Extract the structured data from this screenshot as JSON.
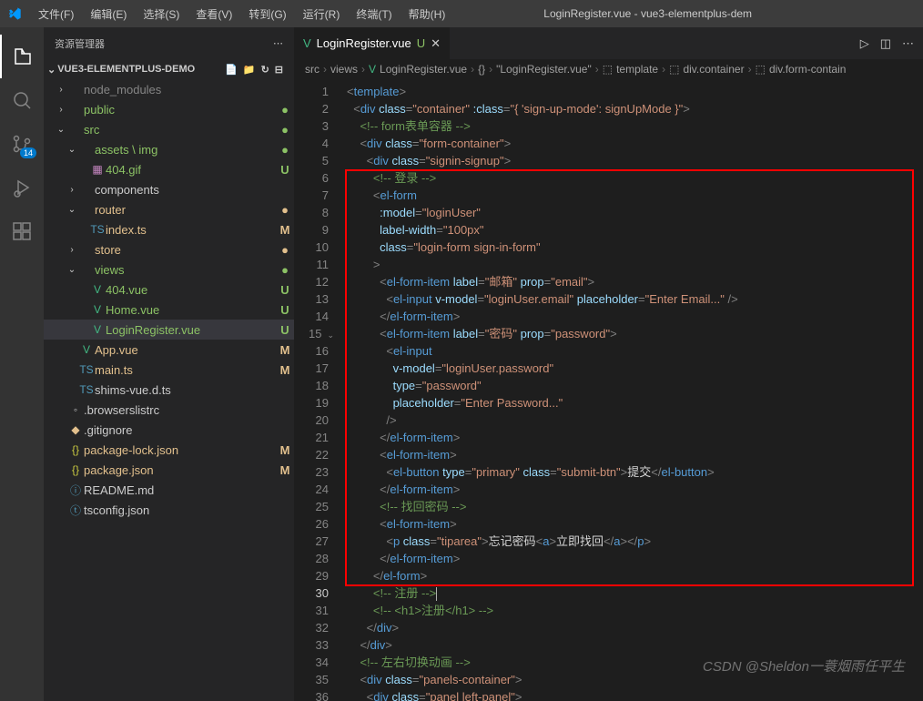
{
  "titlebar": {
    "menus": [
      "文件(F)",
      "编辑(E)",
      "选择(S)",
      "查看(V)",
      "转到(G)",
      "运行(R)",
      "终端(T)",
      "帮助(H)"
    ],
    "title": "LoginRegister.vue - vue3-elementplus-dem"
  },
  "activitybar": {
    "scm_badge": "14"
  },
  "sidebar": {
    "header": "资源管理器",
    "project": "VUE3-ELEMENTPLUS-DEMO",
    "tree": [
      {
        "indent": 1,
        "chev": "›",
        "icon": "",
        "iconClass": "gray",
        "label": "node_modules",
        "labelClass": "gray",
        "status": "",
        "statusClass": ""
      },
      {
        "indent": 1,
        "chev": "›",
        "icon": "",
        "iconClass": "",
        "label": "public",
        "labelClass": "green",
        "status": "●",
        "statusClass": "green"
      },
      {
        "indent": 1,
        "chev": "⌄",
        "icon": "",
        "iconClass": "",
        "label": "src",
        "labelClass": "green",
        "status": "●",
        "statusClass": "green"
      },
      {
        "indent": 2,
        "chev": "⌄",
        "icon": "",
        "iconClass": "",
        "label": "assets \\ img",
        "labelClass": "green",
        "status": "●",
        "statusClass": "green"
      },
      {
        "indent": 3,
        "chev": "",
        "icon": "▦",
        "iconClass": "purple",
        "label": "404.gif",
        "labelClass": "green",
        "status": "U",
        "statusClass": "green"
      },
      {
        "indent": 2,
        "chev": "›",
        "icon": "",
        "iconClass": "",
        "label": "components",
        "labelClass": "",
        "status": "",
        "statusClass": ""
      },
      {
        "indent": 2,
        "chev": "⌄",
        "icon": "",
        "iconClass": "",
        "label": "router",
        "labelClass": "orange",
        "status": "●",
        "statusClass": "orange"
      },
      {
        "indent": 3,
        "chev": "",
        "icon": "TS",
        "iconClass": "blue-ts",
        "label": "index.ts",
        "labelClass": "orange",
        "status": "M",
        "statusClass": "orange"
      },
      {
        "indent": 2,
        "chev": "›",
        "icon": "",
        "iconClass": "",
        "label": "store",
        "labelClass": "orange",
        "status": "●",
        "statusClass": "orange"
      },
      {
        "indent": 2,
        "chev": "⌄",
        "icon": "",
        "iconClass": "",
        "label": "views",
        "labelClass": "green",
        "status": "●",
        "statusClass": "green"
      },
      {
        "indent": 3,
        "chev": "",
        "icon": "V",
        "iconClass": "yellowv",
        "label": "404.vue",
        "labelClass": "green",
        "status": "U",
        "statusClass": "green"
      },
      {
        "indent": 3,
        "chev": "",
        "icon": "V",
        "iconClass": "yellowv",
        "label": "Home.vue",
        "labelClass": "green",
        "status": "U",
        "statusClass": "green"
      },
      {
        "indent": 3,
        "chev": "",
        "icon": "V",
        "iconClass": "yellowv",
        "label": "LoginRegister.vue",
        "labelClass": "green",
        "status": "U",
        "statusClass": "green",
        "selected": true
      },
      {
        "indent": 2,
        "chev": "",
        "icon": "V",
        "iconClass": "yellowv",
        "label": "App.vue",
        "labelClass": "orange",
        "status": "M",
        "statusClass": "orange"
      },
      {
        "indent": 2,
        "chev": "",
        "icon": "TS",
        "iconClass": "blue-ts",
        "label": "main.ts",
        "labelClass": "orange",
        "status": "M",
        "statusClass": "orange"
      },
      {
        "indent": 2,
        "chev": "",
        "icon": "TS",
        "iconClass": "blue-ts",
        "label": "shims-vue.d.ts",
        "labelClass": "",
        "status": "",
        "statusClass": ""
      },
      {
        "indent": 1,
        "chev": "",
        "icon": "◦",
        "iconClass": "",
        "label": ".browserslistrc",
        "labelClass": "",
        "status": "",
        "statusClass": ""
      },
      {
        "indent": 1,
        "chev": "",
        "icon": "◆",
        "iconClass": "orange",
        "label": ".gitignore",
        "labelClass": "",
        "status": "",
        "statusClass": ""
      },
      {
        "indent": 1,
        "chev": "",
        "icon": "{}",
        "iconClass": "yellow-js",
        "label": "package-lock.json",
        "labelClass": "orange",
        "status": "M",
        "statusClass": "orange"
      },
      {
        "indent": 1,
        "chev": "",
        "icon": "{}",
        "iconClass": "yellow-js",
        "label": "package.json",
        "labelClass": "orange",
        "status": "M",
        "statusClass": "orange"
      },
      {
        "indent": 1,
        "chev": "",
        "icon": "ⓘ",
        "iconClass": "blue-ts",
        "label": "README.md",
        "labelClass": "",
        "status": "",
        "statusClass": ""
      },
      {
        "indent": 1,
        "chev": "",
        "icon": "ⓣ",
        "iconClass": "blue-ts",
        "label": "tsconfig.json",
        "labelClass": "",
        "status": "",
        "statusClass": ""
      }
    ]
  },
  "tab": {
    "icon": "V",
    "name": "LoginRegister.vue",
    "status": "U"
  },
  "breadcrumbs": [
    "src",
    "views",
    "LoginRegister.vue",
    "{}",
    "\"LoginRegister.vue\"",
    "template",
    "div.container",
    "div.form-contain"
  ],
  "bc_icons": [
    "",
    "",
    "V",
    "",
    "",
    "⬚",
    "⬚",
    "⬚"
  ],
  "code": {
    "start": 1,
    "current": 30,
    "lines": [
      {
        "i": 0,
        "html": "<span class='t-punc'>&lt;</span><span class='t-tag'>template</span><span class='t-punc'>&gt;</span>"
      },
      {
        "i": 1,
        "html": "<span class='t-punc'>&lt;</span><span class='t-tag'>div</span> <span class='t-attr'>class</span><span class='t-punc'>=</span><span class='t-str'>\"container\"</span> <span class='t-attr'>:class</span><span class='t-punc'>=</span><span class='t-str'>\"{ 'sign-up-mode': signUpMode }\"</span><span class='t-punc'>&gt;</span>"
      },
      {
        "i": 2,
        "html": "<span class='t-comment'>&lt;!-- form表单容器 --&gt;</span>"
      },
      {
        "i": 2,
        "html": "<span class='t-punc'>&lt;</span><span class='t-tag'>div</span> <span class='t-attr'>class</span><span class='t-punc'>=</span><span class='t-str'>\"form-container\"</span><span class='t-punc'>&gt;</span>"
      },
      {
        "i": 3,
        "html": "<span class='t-punc'>&lt;</span><span class='t-tag'>div</span> <span class='t-attr'>class</span><span class='t-punc'>=</span><span class='t-str'>\"signin-signup\"</span><span class='t-punc'>&gt;</span>"
      },
      {
        "i": 4,
        "html": "<span class='t-comment'>&lt;!-- 登录 --&gt;</span>"
      },
      {
        "i": 4,
        "html": "<span class='t-punc'>&lt;</span><span class='t-tag'>el-form</span>"
      },
      {
        "i": 5,
        "html": "<span class='t-attr'>:model</span><span class='t-punc'>=</span><span class='t-str'>\"loginUser\"</span>"
      },
      {
        "i": 5,
        "html": "<span class='t-attr'>label-width</span><span class='t-punc'>=</span><span class='t-str'>\"100px\"</span>"
      },
      {
        "i": 5,
        "html": "<span class='t-attr'>class</span><span class='t-punc'>=</span><span class='t-str'>\"login-form sign-in-form\"</span>"
      },
      {
        "i": 4,
        "html": "<span class='t-punc'>&gt;</span>"
      },
      {
        "i": 5,
        "html": "<span class='t-punc'>&lt;</span><span class='t-tag'>el-form-item</span> <span class='t-attr'>label</span><span class='t-punc'>=</span><span class='t-str'>\"邮箱\"</span> <span class='t-attr'>prop</span><span class='t-punc'>=</span><span class='t-str'>\"email\"</span><span class='t-punc'>&gt;</span>"
      },
      {
        "i": 6,
        "html": "<span class='t-punc'>&lt;</span><span class='t-tag'>el-input</span> <span class='t-attr'>v-model</span><span class='t-punc'>=</span><span class='t-str'>\"loginUser.email\"</span> <span class='t-attr'>placeholder</span><span class='t-punc'>=</span><span class='t-str'>\"Enter Email...\"</span> <span class='t-punc'>/&gt;</span>"
      },
      {
        "i": 5,
        "html": "<span class='t-punc'>&lt;/</span><span class='t-tag'>el-form-item</span><span class='t-punc'>&gt;</span>"
      },
      {
        "i": 5,
        "html": "<span class='t-punc'>&lt;</span><span class='t-tag'>el-form-item</span> <span class='t-attr'>label</span><span class='t-punc'>=</span><span class='t-str'>\"密码\"</span> <span class='t-attr'>prop</span><span class='t-punc'>=</span><span class='t-str'>\"password\"</span><span class='t-punc'>&gt;</span>"
      },
      {
        "i": 6,
        "html": "<span class='t-punc'>&lt;</span><span class='t-tag'>el-input</span>"
      },
      {
        "i": 7,
        "html": "<span class='t-attr'>v-model</span><span class='t-punc'>=</span><span class='t-str'>\"loginUser.password\"</span>"
      },
      {
        "i": 7,
        "html": "<span class='t-attr'>type</span><span class='t-punc'>=</span><span class='t-str'>\"password\"</span>"
      },
      {
        "i": 7,
        "html": "<span class='t-attr'>placeholder</span><span class='t-punc'>=</span><span class='t-str'>\"Enter Password...\"</span>"
      },
      {
        "i": 6,
        "html": "<span class='t-punc'>/&gt;</span>"
      },
      {
        "i": 5,
        "html": "<span class='t-punc'>&lt;/</span><span class='t-tag'>el-form-item</span><span class='t-punc'>&gt;</span>"
      },
      {
        "i": 5,
        "html": "<span class='t-punc'>&lt;</span><span class='t-tag'>el-form-item</span><span class='t-punc'>&gt;</span>"
      },
      {
        "i": 6,
        "html": "<span class='t-punc'>&lt;</span><span class='t-tag'>el-button</span> <span class='t-attr'>type</span><span class='t-punc'>=</span><span class='t-str'>\"primary\"</span> <span class='t-attr'>class</span><span class='t-punc'>=</span><span class='t-str'>\"submit-btn\"</span><span class='t-punc'>&gt;</span><span class='t-text'>提交</span><span class='t-punc'>&lt;/</span><span class='t-tag'>el-button</span><span class='t-punc'>&gt;</span>"
      },
      {
        "i": 5,
        "html": "<span class='t-punc'>&lt;/</span><span class='t-tag'>el-form-item</span><span class='t-punc'>&gt;</span>"
      },
      {
        "i": 5,
        "html": "<span class='t-comment'>&lt;!-- 找回密码 --&gt;</span>"
      },
      {
        "i": 5,
        "html": "<span class='t-punc'>&lt;</span><span class='t-tag'>el-form-item</span><span class='t-punc'>&gt;</span>"
      },
      {
        "i": 6,
        "html": "<span class='t-punc'>&lt;</span><span class='t-tag'>p</span> <span class='t-attr'>class</span><span class='t-punc'>=</span><span class='t-str'>\"tiparea\"</span><span class='t-punc'>&gt;</span><span class='t-text'>忘记密码</span><span class='t-punc'>&lt;</span><span class='t-tag'>a</span><span class='t-punc'>&gt;</span><span class='t-text'>立即找回</span><span class='t-punc'>&lt;/</span><span class='t-tag'>a</span><span class='t-punc'>&gt;&lt;/</span><span class='t-tag'>p</span><span class='t-punc'>&gt;</span>"
      },
      {
        "i": 5,
        "html": "<span class='t-punc'>&lt;/</span><span class='t-tag'>el-form-item</span><span class='t-punc'>&gt;</span>"
      },
      {
        "i": 4,
        "html": "<span class='t-punc'>&lt;/</span><span class='t-tag'>el-form</span><span class='t-punc'>&gt;</span>"
      },
      {
        "i": 4,
        "html": "<span class='t-comment'>&lt;!-- 注册 --&gt;</span><span class='cursor'></span>"
      },
      {
        "i": 4,
        "html": "<span class='t-comment'>&lt;!-- &lt;h1&gt;注册&lt;/h1&gt; --&gt;</span>"
      },
      {
        "i": 3,
        "html": "<span class='t-punc'>&lt;/</span><span class='t-tag'>div</span><span class='t-punc'>&gt;</span>"
      },
      {
        "i": 2,
        "html": "<span class='t-punc'>&lt;/</span><span class='t-tag'>div</span><span class='t-punc'>&gt;</span>"
      },
      {
        "i": 2,
        "html": "<span class='t-comment'>&lt;!-- 左右切换动画 --&gt;</span>"
      },
      {
        "i": 2,
        "html": "<span class='t-punc'>&lt;</span><span class='t-tag'>div</span> <span class='t-attr'>class</span><span class='t-punc'>=</span><span class='t-str'>\"panels-container\"</span><span class='t-punc'>&gt;</span>"
      },
      {
        "i": 3,
        "html": "<span class='t-punc'>&lt;</span><span class='t-tag'>div</span> <span class='t-attr'>class</span><span class='t-punc'>=</span><span class='t-str'>\"panel left-panel\"</span><span class='t-punc'>&gt;</span>"
      }
    ]
  },
  "watermark": "CSDN @Sheldon一蓑烟雨任平生"
}
